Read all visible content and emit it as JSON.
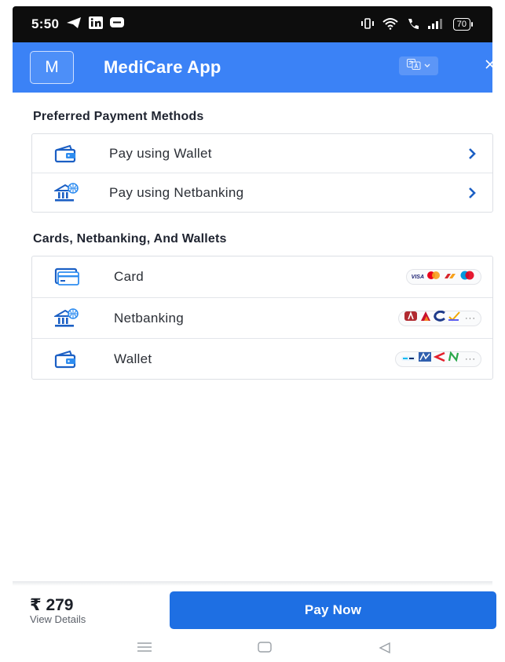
{
  "status_bar": {
    "time": "5:50",
    "battery": "70",
    "icons": [
      "telegram-icon",
      "linkedin-icon",
      "chat-icon",
      "vibrate-icon",
      "wifi-icon",
      "call-icon",
      "signal-icon",
      "battery-icon"
    ]
  },
  "header": {
    "logo_letter": "M",
    "title": "MediCare App",
    "colors": {
      "primary": "#3b82f6"
    }
  },
  "preferred": {
    "title": "Preferred Payment Methods",
    "items": [
      {
        "label": "Pay using Wallet",
        "icon": "wallet-icon"
      },
      {
        "label": "Pay using Netbanking",
        "icon": "bank-icon"
      }
    ]
  },
  "others": {
    "title": "Cards, Netbanking, And Wallets",
    "items": [
      {
        "label": "Card",
        "icon": "card-icon",
        "badge_text": "VISA"
      },
      {
        "label": "Netbanking",
        "icon": "bank-icon",
        "badge_more": "···"
      },
      {
        "label": "Wallet",
        "icon": "wallet-icon",
        "badge_more": "···"
      }
    ]
  },
  "footer": {
    "amount": "₹ 279",
    "view_details": "View Details",
    "pay_button": "Pay Now",
    "colors": {
      "button": "#1e6fe3"
    }
  },
  "nav": [
    "menu-icon",
    "home-icon",
    "back-icon"
  ]
}
